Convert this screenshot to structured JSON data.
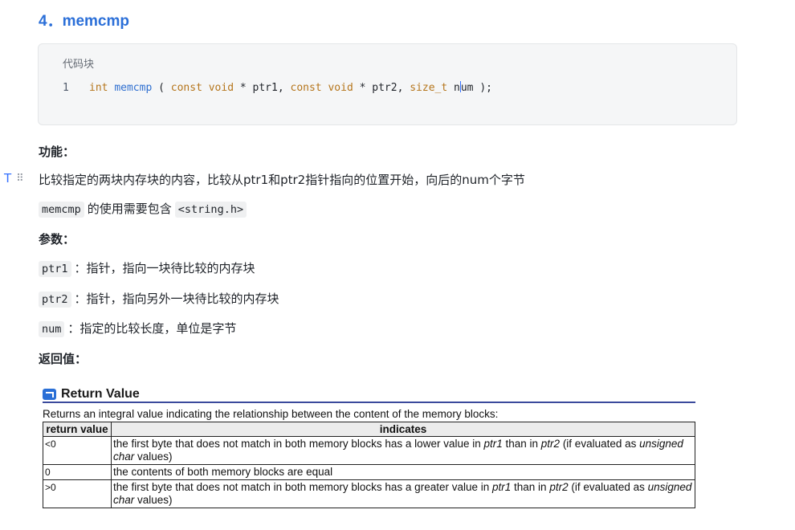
{
  "heading": "4．memcmp",
  "code": {
    "language_label": "代码块",
    "line_number": "1",
    "tokens": {
      "t1": "int",
      "t2": "memcmp",
      "t3": " ( ",
      "t4": "const",
      "t5": " ",
      "t6": "void",
      "t7": " * ptr1, ",
      "t8": "const",
      "t9": " ",
      "t10": "void",
      "t11": " * ptr2, ",
      "t12": "size_t",
      "t13": " n",
      "t14": "um );"
    }
  },
  "sections": {
    "function_label": "功能：",
    "function_desc": "比较指定的两块内存块的内容，比较从ptr1和ptr2指针指向的位置开始，向后的num个字节",
    "include_chip": "memcmp",
    "include_text": "的使用需要包含",
    "include_header_chip": "<string.h>",
    "params_label": "参数：",
    "params": [
      {
        "name": "ptr1",
        "desc": "：指针，指向一块待比较的内存块"
      },
      {
        "name": "ptr2",
        "desc": "：指针，指向另外一块待比较的内存块"
      },
      {
        "name": "num",
        "desc": "：指定的比较长度，单位是字节"
      }
    ],
    "return_label": "返回值："
  },
  "return_value": {
    "title": "Return Value",
    "description": "Returns an integral value indicating the relationship between the content of the memory blocks:",
    "headers": {
      "col1": "return value",
      "col2": "indicates"
    },
    "rows": [
      {
        "value": "<0",
        "p1": "the first byte that does not match in both memory blocks has a lower value in ",
        "i1": "ptr1",
        "p2": " than in ",
        "i2": "ptr2",
        "p3": " (if evaluated as ",
        "i3": "unsigned char",
        "p4": " values)"
      },
      {
        "value": "0",
        "p1": "the contents of both memory blocks are equal"
      },
      {
        "value": ">0",
        "p1": "the first byte that does not match in both memory blocks has a greater value in ",
        "i1": "ptr1",
        "p2": " than in ",
        "i2": "ptr2",
        "p3": " (if evaluated as ",
        "i3": "unsigned char",
        "p4": " values)"
      }
    ]
  },
  "colors": {
    "heading": "#2b6fd8",
    "keyword": "#b5751b",
    "function_name": "#2f6fd0",
    "cursor": "#3370ff"
  },
  "icons": {
    "side_text_tool": "text-format-icon",
    "side_drag": "drag-handle-icon",
    "return_value_arrow": "return-arrow-icon"
  }
}
